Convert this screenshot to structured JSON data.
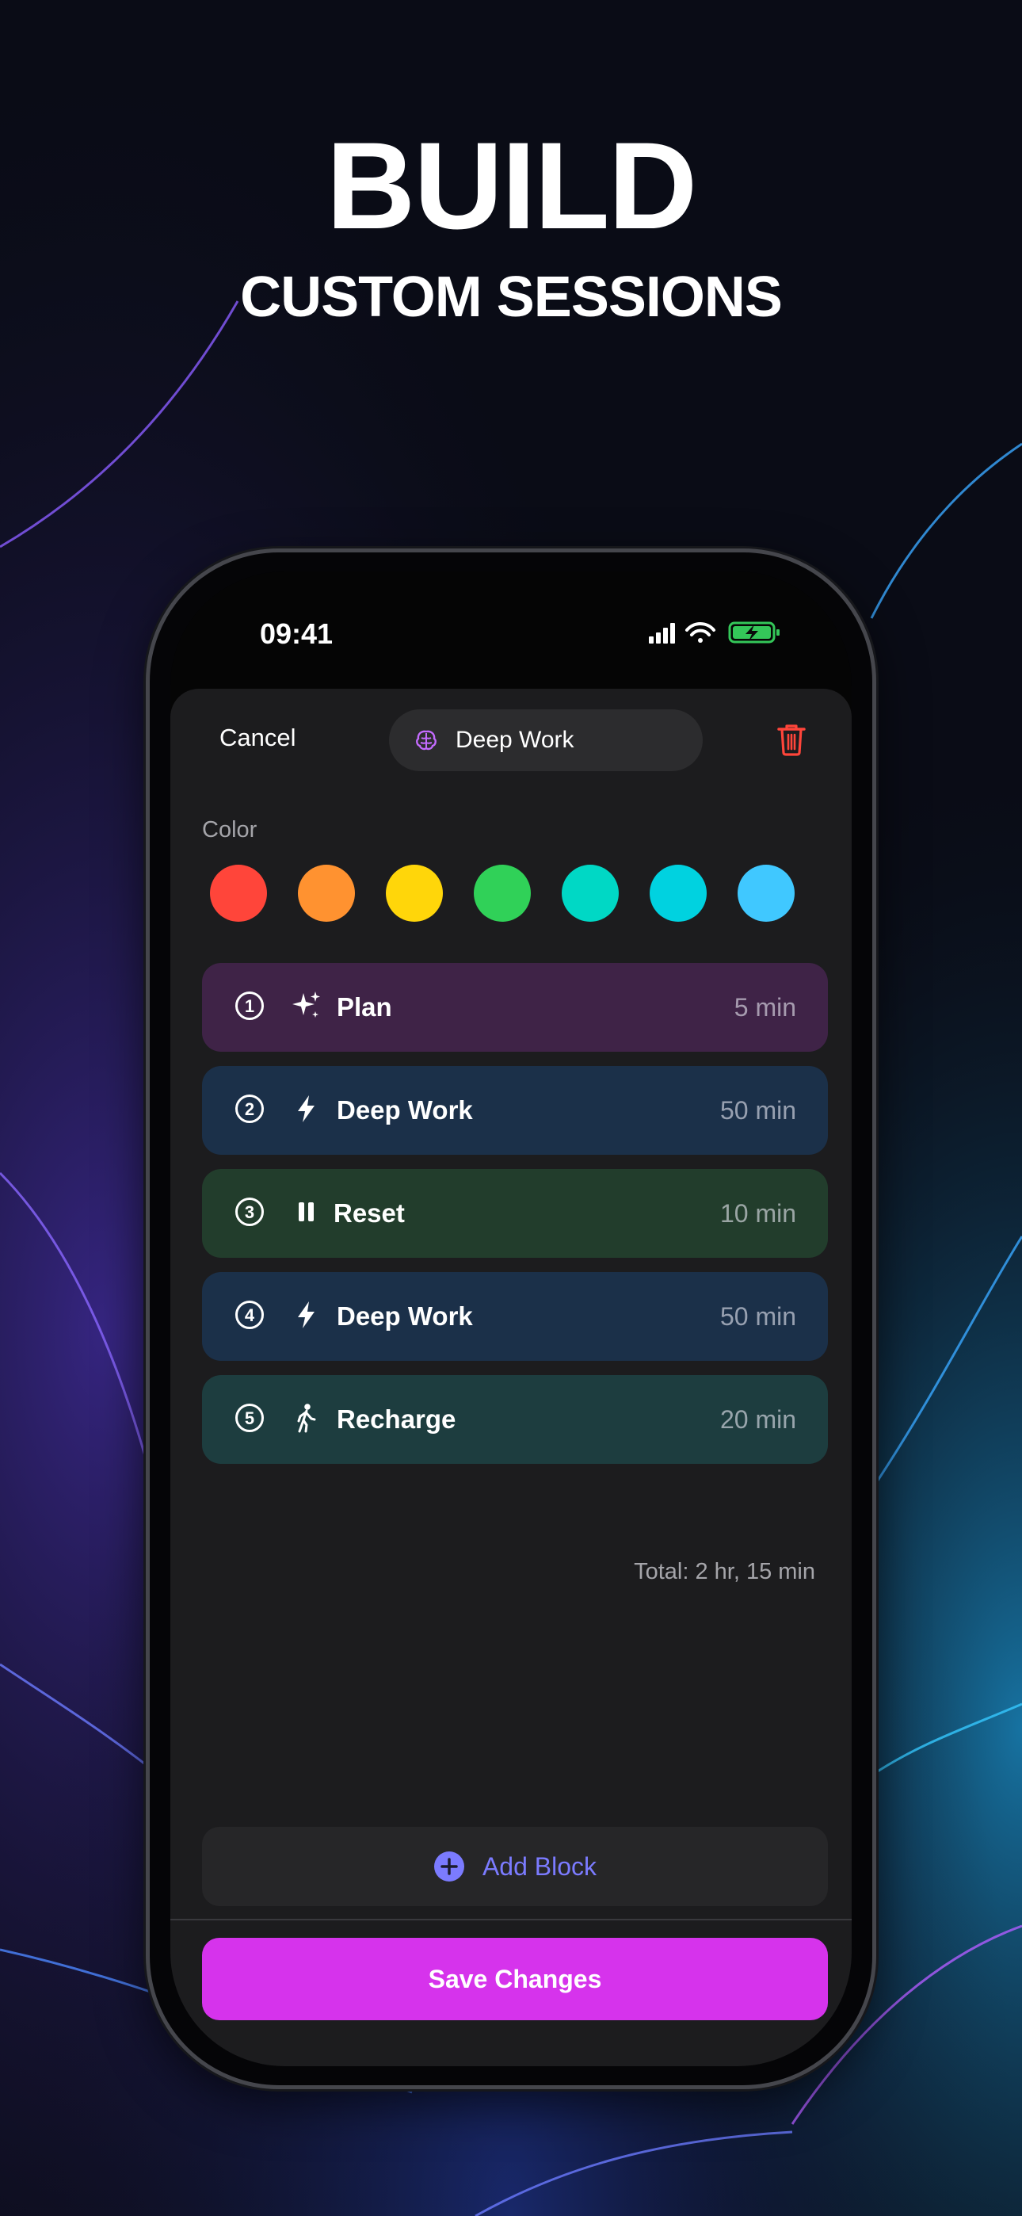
{
  "headline": {
    "line1": "BUILD",
    "line2": "CUSTOM SESSIONS"
  },
  "status_bar": {
    "time": "09:41",
    "icons": [
      "signal-icon",
      "wifi-icon",
      "battery-charging-icon"
    ]
  },
  "editor": {
    "cancel_label": "Cancel",
    "session_title": "Deep Work",
    "session_icon": "brain-icon",
    "delete_icon": "trash-icon",
    "color_label": "Color",
    "colors": [
      "#ff453a",
      "#ff9230",
      "#ffd60a",
      "#30d158",
      "#00d8c5",
      "#00d2e0",
      "#40c8ff"
    ],
    "blocks": [
      {
        "index": "1",
        "icon": "sparkles-icon",
        "name": "Plan",
        "duration": "5 min",
        "bg": "#3f2347"
      },
      {
        "index": "2",
        "icon": "bolt-icon",
        "name": "Deep Work",
        "duration": "50 min",
        "bg": "#1b3049"
      },
      {
        "index": "3",
        "icon": "pause-icon",
        "name": "Reset",
        "duration": "10 min",
        "bg": "#223d2c"
      },
      {
        "index": "4",
        "icon": "bolt-icon",
        "name": "Deep Work",
        "duration": "50 min",
        "bg": "#1b3049"
      },
      {
        "index": "5",
        "icon": "walking-icon",
        "name": "Recharge",
        "duration": "20 min",
        "bg": "#1d3d3f"
      }
    ],
    "total": "Total: 2 hr, 15 min",
    "add_block_label": "Add Block",
    "save_label": "Save Changes"
  }
}
